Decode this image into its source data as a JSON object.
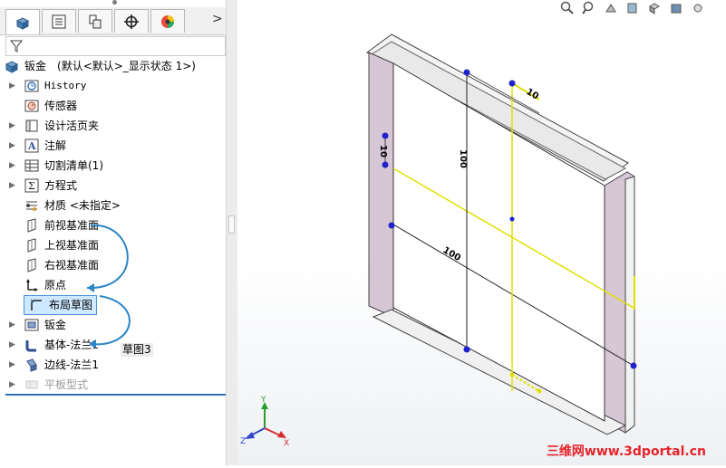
{
  "tabs": [
    {
      "name": "feature-manager",
      "active": true
    },
    {
      "name": "property-manager",
      "active": false
    },
    {
      "name": "configuration-manager",
      "active": false
    },
    {
      "name": "dimxpert-manager",
      "active": false
    },
    {
      "name": "display-manager",
      "active": false
    }
  ],
  "tab_more": ">",
  "root": {
    "label": "钣金",
    "config": "(默认<默认>_显示状态 1>)"
  },
  "tree": [
    {
      "label": "History",
      "icon": "history-icon",
      "expandable": true
    },
    {
      "label": "传感器",
      "icon": "sensor-icon",
      "expandable": false
    },
    {
      "label": "设计活页夹",
      "icon": "design-binder-icon",
      "expandable": true
    },
    {
      "label": "注解",
      "icon": "annotations-icon",
      "expandable": true
    },
    {
      "label": "切割清单(1)",
      "icon": "cut-list-icon",
      "expandable": true
    },
    {
      "label": "方程式",
      "icon": "equations-icon",
      "expandable": true
    },
    {
      "label": "材质 <未指定>",
      "icon": "material-icon",
      "expandable": false
    },
    {
      "label": "前视基准面",
      "icon": "plane-icon",
      "expandable": false
    },
    {
      "label": "上视基准面",
      "icon": "plane-icon",
      "expandable": false
    },
    {
      "label": "右视基准面",
      "icon": "plane-icon",
      "expandable": false
    },
    {
      "label": "原点",
      "icon": "origin-icon",
      "expandable": false
    },
    {
      "label": "布局草图",
      "icon": "sketch-icon",
      "expandable": false,
      "selected": true
    },
    {
      "label": "钣金",
      "icon": "sheet-metal-icon",
      "expandable": true
    },
    {
      "label": "基体-法兰1",
      "icon": "base-flange-icon",
      "expandable": true
    },
    {
      "label": "边线-法兰1",
      "icon": "edge-flange-icon",
      "expandable": true
    },
    {
      "label": "平板型式",
      "icon": "flat-pattern-icon",
      "expandable": true,
      "suppressed": true
    }
  ],
  "drag_tooltip": "草图3",
  "dimensions": {
    "d1": "10",
    "d2": "10",
    "d3": "100",
    "d4": "100"
  },
  "triad": {
    "x": "X",
    "y": "Y",
    "z": "Z"
  },
  "watermark": "三维网www.3dportal.cn",
  "colors": {
    "accent": "#2d6fb8",
    "selection": "#cde8ff",
    "sketch": "#e0e000",
    "flange": "#d7c6d4",
    "arrow": "#2b85c6"
  }
}
